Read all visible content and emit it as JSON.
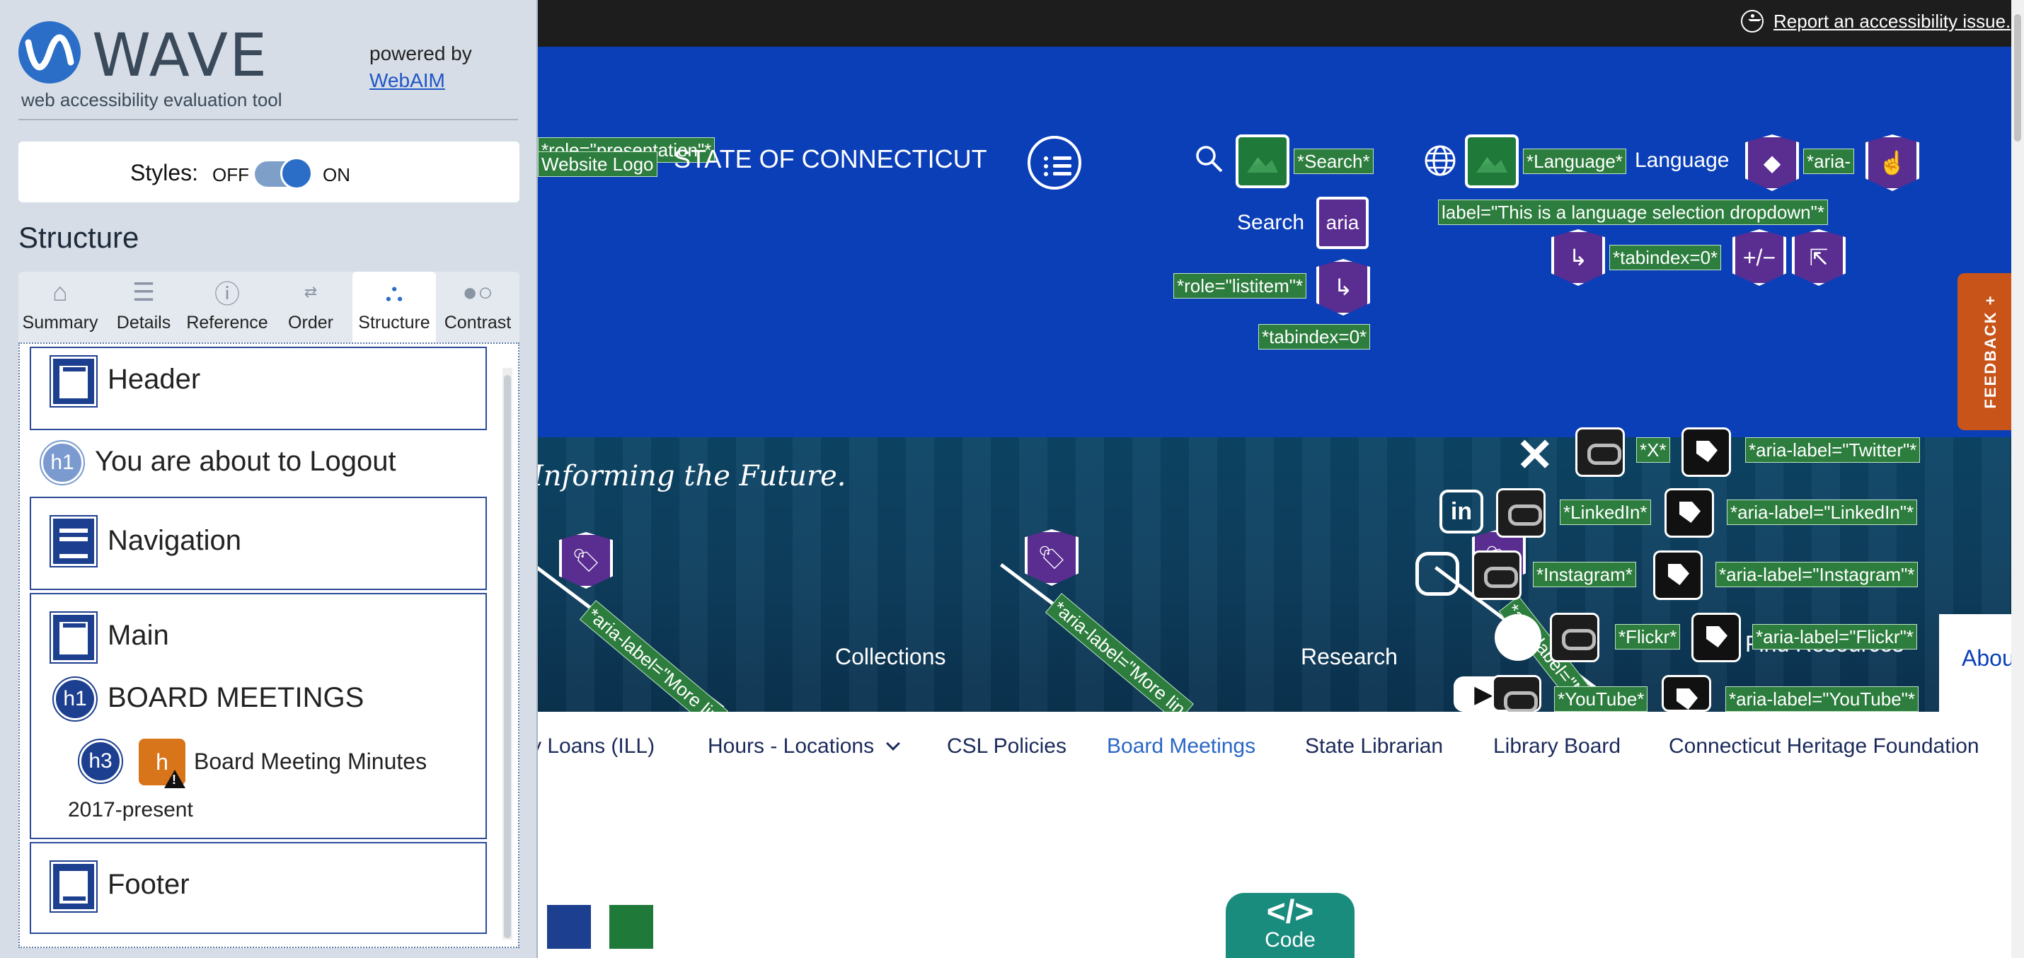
{
  "topbar": {
    "report_link": "Report an accessibility issue."
  },
  "header": {
    "site_title": "STATE OF CONNECTICUT",
    "search_label": "Search",
    "language_label": "Language",
    "aria_short": "aria",
    "plus_minus": "+/−"
  },
  "wave_labels": {
    "presentation": "*role=\"presentation\"*",
    "website_logo": "Website Logo",
    "search": "*Search*",
    "language": "*Language*",
    "aria_lang_start": "*aria-",
    "aria_lang_end": "label=\"This is a language selection dropdown\"*",
    "tabindex_a": "*tabindex=0*",
    "tabindex_b": "*tabindex=0*",
    "listitem": "*role=\"listitem\"*",
    "x": "*X*",
    "aria_twitter": "*aria-label=\"Twitter\"*",
    "linkedin": "*LinkedIn*",
    "aria_linkedin": "*aria-label=\"LinkedIn\"*",
    "instagram": "*Instagram*",
    "aria_instagram": "*aria-label=\"Instagram\"*",
    "flickr": "*Flickr*",
    "aria_flickr": "*aria-label=\"Flickr\"*",
    "youtube": "*YouTube*",
    "aria_youtube": "*aria-label=\"YouTube\"*",
    "more_link_1": "*aria-label=\"More lin",
    "more_link_2": "*aria-label=\"More lin",
    "more_link_3": "*aria-label=\"More lin"
  },
  "hero": {
    "tagline": "Informing the Future.",
    "nav": [
      "Collections",
      "Research",
      "Find Resources",
      "Abou"
    ]
  },
  "subnav": {
    "items": [
      "ry Loans (ILL)",
      "Hours - Locations",
      "CSL Policies",
      "Board Meetings",
      "State Librarian",
      "Library Board",
      "Connecticut Heritage Foundation"
    ],
    "active": "Board Meetings"
  },
  "feedback": {
    "label": "FEEDBACK +"
  },
  "code_button": {
    "symbol": "</>",
    "label": "Code"
  },
  "wave": {
    "title": "WAVE",
    "subtitle": "web accessibility evaluation tool",
    "powered_by": "powered by",
    "webaim": "WebAIM",
    "styles_label": "Styles:",
    "styles_off": "OFF",
    "styles_on": "ON",
    "section_title": "Structure",
    "tabs": [
      {
        "label": "Summary",
        "icon": "home-icon"
      },
      {
        "label": "Details",
        "icon": "list-icon"
      },
      {
        "label": "Reference",
        "icon": "info-icon"
      },
      {
        "label": "Order",
        "icon": "order-icon"
      },
      {
        "label": "Structure",
        "icon": "structure-icon"
      },
      {
        "label": "Contrast",
        "icon": "contrast-icon"
      }
    ],
    "active_tab": "Structure",
    "structure": {
      "header": "Header",
      "logout_h1_badge": "h1",
      "logout_h1": "You are about to Logout",
      "navigation": "Navigation",
      "main": "Main",
      "board_h1_badge": "h1",
      "board_h1": "BOARD MEETINGS",
      "minutes_h3_badge": "h3",
      "minutes_h_badge": "h",
      "minutes_line1": "Board Meeting Minutes",
      "minutes_line2": "2017-present",
      "footer": "Footer"
    }
  },
  "colors": {
    "header_blue": "#0b3fb8",
    "wave_green_label": "#2d7d3e",
    "aria_purple": "#5a2d91",
    "feedback_orange": "#c8541a",
    "code_teal": "#1a8c7e",
    "active_link": "#2a66c7"
  }
}
